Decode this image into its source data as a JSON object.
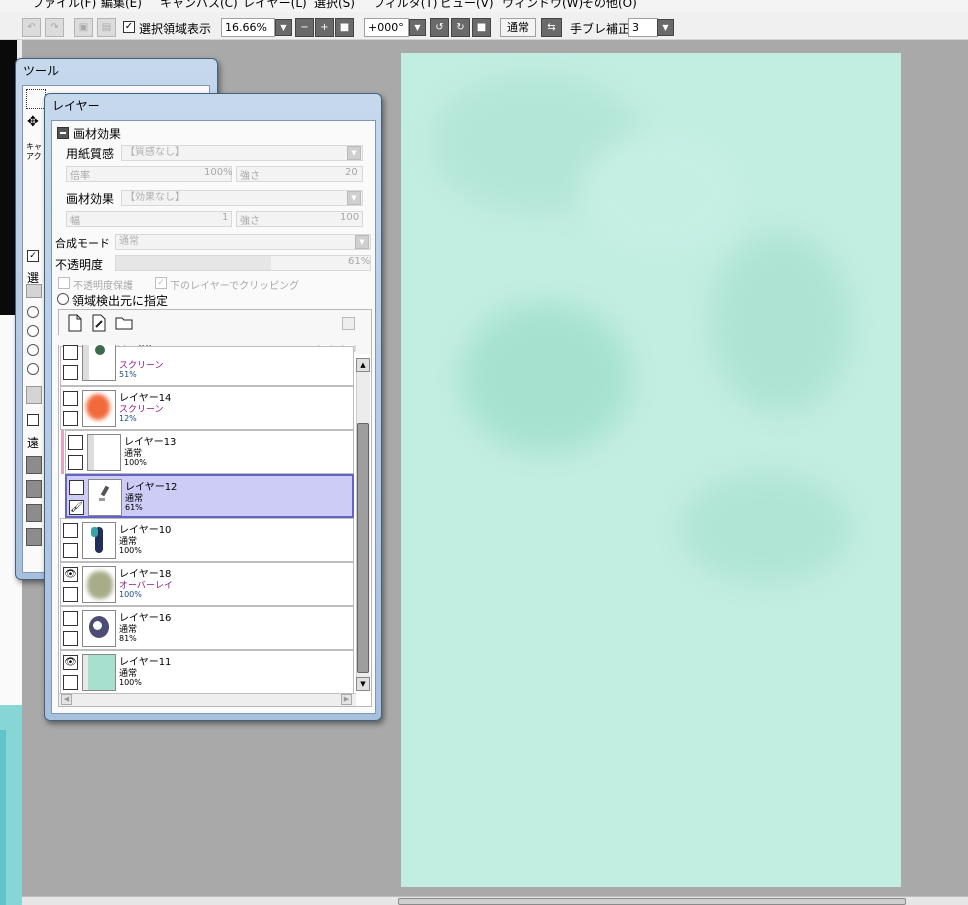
{
  "menu": [
    "ファイル(F)",
    "編集(E)",
    "キャンバス(C)",
    "レイヤー(L)",
    "選択(S)",
    "フィルタ(T)",
    "ビュー(V)",
    "ウィンドウ(W)",
    "その他(O)"
  ],
  "toolbar": {
    "show_selection_label": "選択領域表示",
    "show_selection_checked": "✓",
    "zoom": "16.66%",
    "rotation": "+000°",
    "blend_button": "通常",
    "stabilizer_label": "手ブレ補正",
    "stabilizer_value": "3"
  },
  "tool_window": {
    "title": "ツール",
    "partial_label_1": "キャ",
    "partial_label_2": "アク",
    "partial_label_3": "選",
    "partial_label_4": "遠",
    "check_mark": "✓"
  },
  "layer_window": {
    "title": "レイヤー",
    "material_effect_header": "画材効果",
    "paper_texture_label": "用紙質感",
    "paper_texture_value": "【質感なし】",
    "scale_label": "倍率",
    "scale_value": "100%",
    "strength_label": "強さ",
    "strength_value": "20",
    "effect_label": "画材効果",
    "effect_value": "【効果なし】",
    "width_label": "幅",
    "width_value": "1",
    "effect_strength_label": "強さ",
    "effect_strength_value": "100",
    "blend_mode_label": "合成モード",
    "blend_mode_value": "通常",
    "opacity_label": "不透明度",
    "opacity_value": "61%",
    "opacity_fraction": 0.61,
    "protect_opacity_label": "不透明度保護",
    "clip_label": "下のレイヤーでクリッピング",
    "region_source_label": "領域検出元に指定",
    "layers": [
      {
        "name": "",
        "mode": "スクリーン",
        "opacity": "51%",
        "visible": "",
        "tool": "",
        "thumb": "plant"
      },
      {
        "name": "レイヤー14",
        "mode": "スクリーン",
        "opacity": "12%",
        "visible": "",
        "tool": "",
        "thumb": "orange"
      },
      {
        "name": "レイヤー13",
        "mode": "通常",
        "opacity": "100%",
        "visible": "",
        "tool": "",
        "thumb": "white"
      },
      {
        "name": "レイヤー12",
        "mode": "通常",
        "opacity": "61%",
        "visible": "",
        "tool": "🖌",
        "thumb": "sketch"
      },
      {
        "name": "レイヤー10",
        "mode": "通常",
        "opacity": "100%",
        "visible": "",
        "tool": "",
        "thumb": "figure"
      },
      {
        "name": "レイヤー18",
        "mode": "オーバーレイ",
        "opacity": "100%",
        "visible": "👁",
        "tool": "",
        "thumb": "olive"
      },
      {
        "name": "レイヤー16",
        "mode": "通常",
        "opacity": "81%",
        "visible": "",
        "tool": "",
        "thumb": "flower"
      },
      {
        "name": "レイヤー11",
        "mode": "通常",
        "opacity": "100%",
        "visible": "👁",
        "tool": "",
        "thumb": "teal"
      }
    ]
  },
  "colors": {
    "canvas": "#c2eee2",
    "workspace": "#a9a9a9",
    "selected_layer": "#ccccf6",
    "selected_border": "#6464c8",
    "mode_color": "#8a1a8a"
  }
}
